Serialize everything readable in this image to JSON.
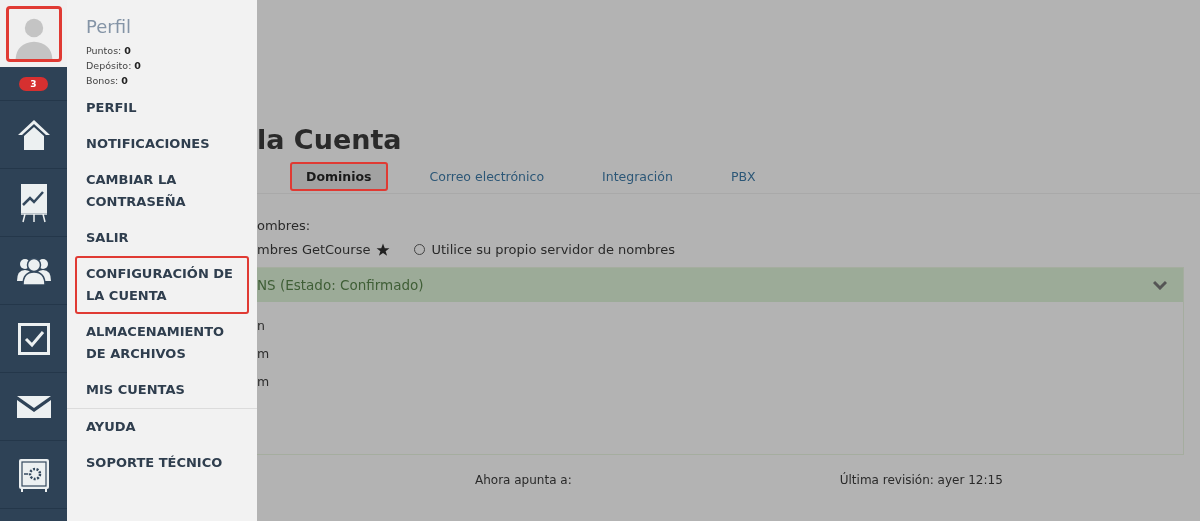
{
  "nav": {
    "avatar_highlighted": true,
    "badge": "3",
    "icons": [
      {
        "kind": "home"
      },
      {
        "kind": "chart"
      },
      {
        "kind": "people"
      },
      {
        "kind": "check"
      },
      {
        "kind": "mail"
      },
      {
        "kind": "safe"
      }
    ]
  },
  "profile_menu": {
    "title": "Perfil",
    "stats": [
      {
        "label": "Puntos:",
        "value": "0"
      },
      {
        "label": "Depósito:",
        "value": "0"
      },
      {
        "label": "Bonos:",
        "value": "0"
      }
    ],
    "items": [
      {
        "label": "PERFIL",
        "highlighted": false
      },
      {
        "label": "NOTIFICACIONES",
        "highlighted": false
      },
      {
        "label": "CAMBIAR LA CONTRASEÑA",
        "highlighted": false
      },
      {
        "label": "SALIR",
        "highlighted": false
      },
      {
        "label": "CONFIGURACIÓN DE LA CUENTA",
        "highlighted": true
      },
      {
        "label": "ALMACENAMIENTO DE ARCHIVOS",
        "highlighted": false
      },
      {
        "label": "MIS CUENTAS",
        "highlighted": false
      }
    ],
    "help_items": [
      {
        "label": "AYUDA",
        "highlighted": false
      },
      {
        "label": "SOPORTE TÉCNICO",
        "highlighted": false
      }
    ]
  },
  "page": {
    "title": "la Cuenta",
    "tabs": [
      {
        "label": "Dominios",
        "selected": true,
        "highlighted": true
      },
      {
        "label": "Correo electrónico",
        "selected": false,
        "highlighted": false
      },
      {
        "label": "Integración",
        "selected": false,
        "highlighted": false
      },
      {
        "label": "PBX",
        "selected": false,
        "highlighted": false
      }
    ],
    "nameserver_label": "ombres:",
    "options": [
      {
        "kind": "starred",
        "label": "mbres GetCourse"
      },
      {
        "kind": "radio",
        "label": "Utilice su propio servidor de nombres",
        "selected": false
      }
    ],
    "panel": {
      "title": "NS (Estado: Confirmado)",
      "expanded": true,
      "lines": [
        "n",
        "m",
        "m"
      ]
    },
    "footer": [
      "Ahora apunta a:",
      "Última revisión: ayer 12:15"
    ]
  }
}
